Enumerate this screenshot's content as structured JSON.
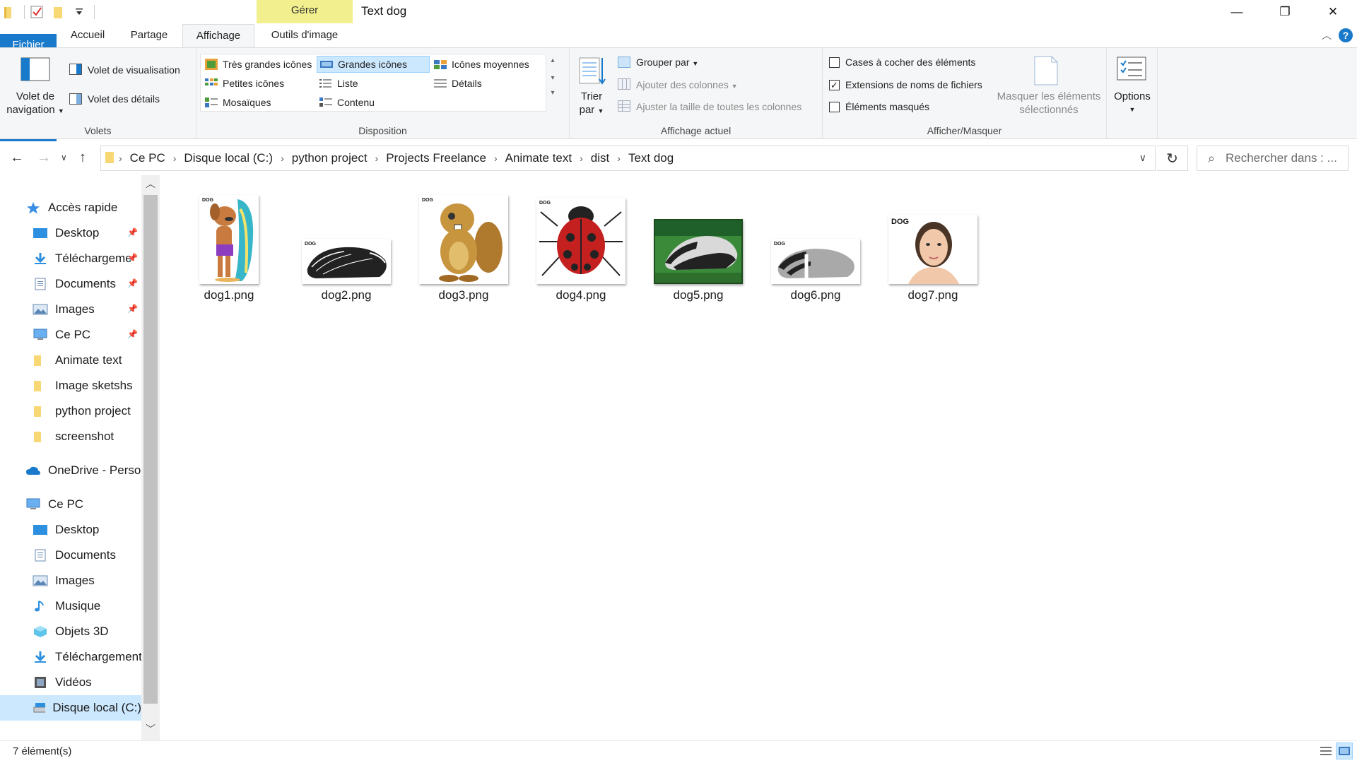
{
  "window": {
    "title": "Text dog",
    "contextual_tab_header": "Gérer",
    "minimize": "—",
    "restore": "❐",
    "close": "✕"
  },
  "tabs": [
    "Fichier",
    "Accueil",
    "Partage",
    "Affichage",
    "Outils d'image"
  ],
  "selected_tab": "Affichage",
  "ribbon": {
    "volets": {
      "group_label": "Volets",
      "nav_pane_line1": "Volet de",
      "nav_pane_line2": "navigation",
      "preview_pane": "Volet de visualisation",
      "details_pane": "Volet des détails"
    },
    "disposition": {
      "group_label": "Disposition",
      "items": [
        "Très grandes icônes",
        "Grandes icônes",
        "Icônes moyennes",
        "Petites icônes",
        "Liste",
        "Détails",
        "Mosaïques",
        "Contenu"
      ],
      "selected": "Grandes icônes"
    },
    "affichage_actuel": {
      "group_label": "Affichage actuel",
      "sort_line1": "Trier",
      "sort_line2": "par",
      "group_by": "Grouper par",
      "add_columns": "Ajouter des colonnes",
      "fit_columns": "Ajuster la taille de toutes les colonnes"
    },
    "afficher_masquer": {
      "group_label": "Afficher/Masquer",
      "checkboxes": [
        {
          "label": "Cases à cocher des éléments",
          "checked": false
        },
        {
          "label": "Extensions de noms de fichiers",
          "checked": true
        },
        {
          "label": "Éléments masqués",
          "checked": false
        }
      ],
      "hide_selected_line1": "Masquer les éléments",
      "hide_selected_line2": "sélectionnés"
    },
    "options": {
      "label": "Options"
    }
  },
  "address": {
    "crumbs": [
      "Ce PC",
      "Disque local (C:)",
      "python project",
      "Projects Freelance",
      "Animate text",
      "dist",
      "Text dog"
    ],
    "search_placeholder": "Rechercher dans : ..."
  },
  "nav_pane": {
    "items": [
      {
        "label": "Accès rapide",
        "icon": "star-icon",
        "pinned": false
      },
      {
        "label": "Desktop",
        "icon": "desktop-folder-icon",
        "pinned": true
      },
      {
        "label": "Téléchargeme",
        "icon": "download-icon",
        "pinned": true
      },
      {
        "label": "Documents",
        "icon": "documents-icon",
        "pinned": true
      },
      {
        "label": "Images",
        "icon": "images-icon",
        "pinned": true
      },
      {
        "label": "Ce PC",
        "icon": "computer-icon",
        "pinned": true
      },
      {
        "label": "Animate text",
        "icon": "folder-icon",
        "pinned": false
      },
      {
        "label": "Image sketshs",
        "icon": "folder-icon",
        "pinned": false
      },
      {
        "label": "python project",
        "icon": "folder-icon",
        "pinned": false
      },
      {
        "label": "screenshot",
        "icon": "folder-icon",
        "pinned": false
      },
      {
        "label": "OneDrive - Person",
        "icon": "cloud-icon",
        "pinned": false
      },
      {
        "label": "Ce PC",
        "icon": "computer-icon",
        "pinned": false
      },
      {
        "label": "Desktop",
        "icon": "desktop-folder-icon",
        "pinned": false
      },
      {
        "label": "Documents",
        "icon": "documents-icon",
        "pinned": false
      },
      {
        "label": "Images",
        "icon": "images-icon",
        "pinned": false
      },
      {
        "label": "Musique",
        "icon": "music-icon",
        "pinned": false
      },
      {
        "label": "Objets 3D",
        "icon": "cube-icon",
        "pinned": false
      },
      {
        "label": "Téléchargements",
        "icon": "download-icon",
        "pinned": false
      },
      {
        "label": "Vidéos",
        "icon": "video-icon",
        "pinned": false
      },
      {
        "label": "Disque local (C:)",
        "icon": "drive-icon",
        "pinned": false
      }
    ],
    "selected": "Disque local (C:)"
  },
  "files": [
    {
      "name": "dog1.png",
      "thumb": "cartoon-dog-surfboard"
    },
    {
      "name": "dog2.png",
      "thumb": "badger-sketch"
    },
    {
      "name": "dog3.png",
      "thumb": "cartoon-beaver"
    },
    {
      "name": "dog4.png",
      "thumb": "ladybug"
    },
    {
      "name": "dog5.png",
      "thumb": "badger-forest"
    },
    {
      "name": "dog6.png",
      "thumb": "badger-grey"
    },
    {
      "name": "dog7.png",
      "thumb": "woman-portrait"
    }
  ],
  "thumb_tag": "DOG",
  "status": {
    "count": "7 élément(s)"
  },
  "colors": {
    "accent": "#1979ca",
    "selection": "#cce8ff",
    "contextual": "#f2f08e"
  }
}
